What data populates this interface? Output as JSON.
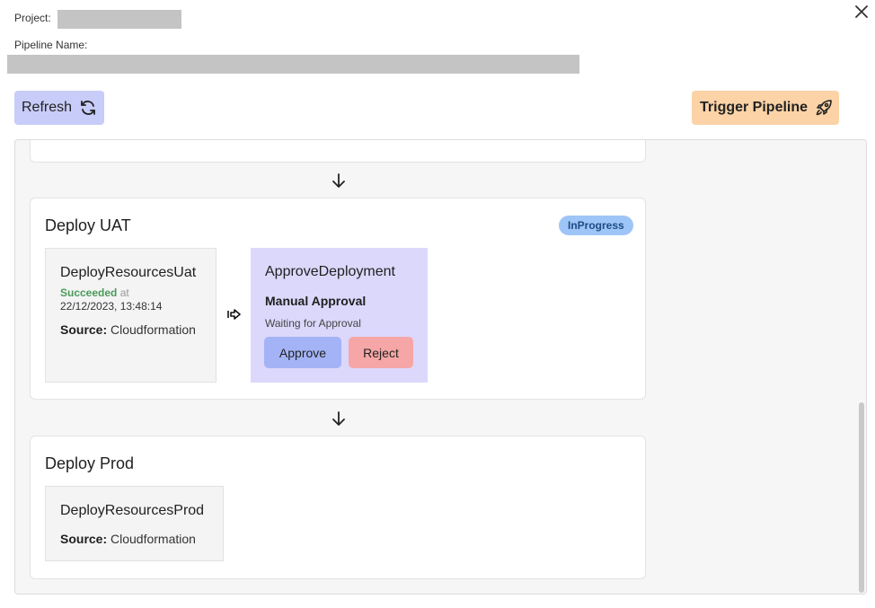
{
  "header": {
    "project_label": "Project:",
    "pipeline_label": "Pipeline Name:"
  },
  "toolbar": {
    "refresh_label": "Refresh",
    "trigger_label": "Trigger Pipeline"
  },
  "icons": {
    "close": "close-icon",
    "refresh": "refresh-icon",
    "rocket": "rocket-icon",
    "arrow_down": "arrow-down-icon",
    "transition": "transition-arrow-icon"
  },
  "colors": {
    "refresh_bg": "#c8ccf8",
    "trigger_bg": "#fbd3a6",
    "badge_bg": "#9ec5f7",
    "approval_bg": "#dcd8fb",
    "approve_bg": "#a3b3f6",
    "reject_bg": "#f6a6a6",
    "succeeded": "#4a9a5a"
  },
  "stages": [
    {
      "title": "Deploy UAT",
      "status": "InProgress",
      "actions": [
        {
          "name": "DeployResourcesUat",
          "status": "Succeeded",
          "at": "at",
          "timestamp": "22/12/2023, 13:48:14",
          "source_label": "Source:",
          "source": "Cloudformation"
        },
        {
          "name": "ApproveDeployment",
          "type": "Manual Approval",
          "message": "Waiting for Approval",
          "approve_label": "Approve",
          "reject_label": "Reject"
        }
      ]
    },
    {
      "title": "Deploy Prod",
      "actions": [
        {
          "name": "DeployResourcesProd",
          "source_label": "Source:",
          "source": "Cloudformation"
        }
      ]
    }
  ]
}
